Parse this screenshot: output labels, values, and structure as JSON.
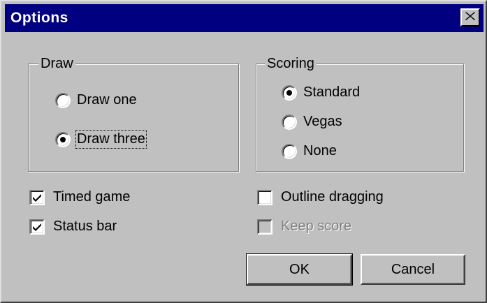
{
  "window": {
    "title": "Options",
    "close_icon": "close-icon"
  },
  "draw": {
    "label": "Draw",
    "options": [
      {
        "label": "Draw one",
        "selected": false
      },
      {
        "label": "Draw three",
        "selected": true
      }
    ]
  },
  "scoring": {
    "label": "Scoring",
    "options": [
      {
        "label": "Standard",
        "selected": true
      },
      {
        "label": "Vegas",
        "selected": false
      },
      {
        "label": "None",
        "selected": false
      }
    ]
  },
  "checks": {
    "timed_game": {
      "label": "Timed game",
      "checked": true
    },
    "status_bar": {
      "label": "Status bar",
      "checked": true
    },
    "outline_dragging": {
      "label": "Outline dragging",
      "checked": false
    },
    "keep_score": {
      "label": "Keep score",
      "checked": false,
      "disabled": true
    }
  },
  "buttons": {
    "ok": "OK",
    "cancel": "Cancel"
  },
  "colors": {
    "face": "#c0c0c0",
    "titlebar": "#000080",
    "title_text": "#ffffff"
  }
}
